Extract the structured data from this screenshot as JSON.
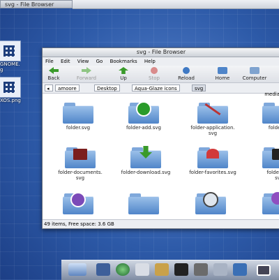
{
  "taskbar": {
    "title": "svg - File Browser"
  },
  "desktop": {
    "icons": [
      {
        "label": "GNOME.",
        "label2": "g"
      },
      {
        "label": "XOS.png"
      }
    ]
  },
  "window": {
    "title": "svg - File Browser",
    "menu": [
      "File",
      "Edit",
      "View",
      "Go",
      "Bookmarks",
      "Help"
    ],
    "toolbar": {
      "back": "Back",
      "forward": "Forward",
      "up": "Up",
      "stop": "Stop",
      "reload": "Reload",
      "home": "Home",
      "computer": "Computer"
    },
    "path": [
      "amoore",
      "Desktop",
      "Aqua-Glaze icons",
      "svg"
    ],
    "partial_label": "media",
    "items_row1": [
      "folder.svg",
      "folder-add.svg",
      "folder-application.\nsvg",
      "folder-c"
    ],
    "items_row2": [
      "folder-documents.\nsvg",
      "folder-download.svg",
      "folder-favorites.svg",
      "folder-na\nsv"
    ],
    "status": "49 items, Free space: 3.6 GB"
  },
  "colors": {
    "accent": "#4f85c9",
    "desktop": "#2f5aa6"
  }
}
